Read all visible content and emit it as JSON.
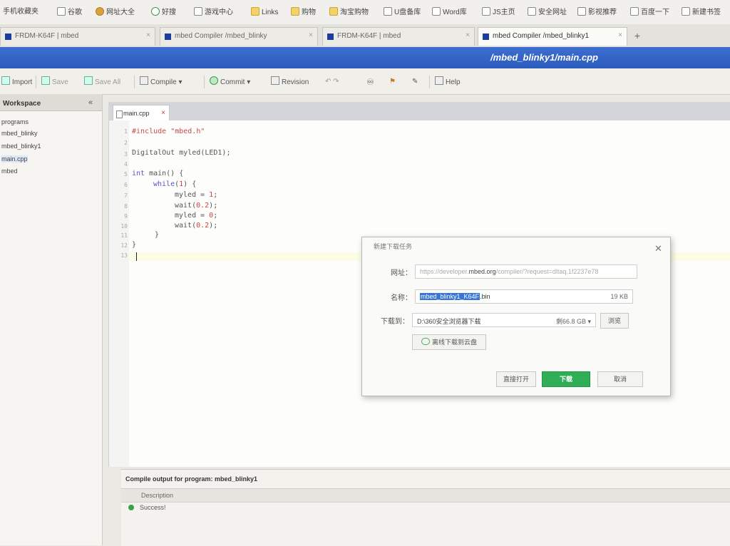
{
  "bookmarks": [
    {
      "label": "手机收藏夹"
    },
    {
      "label": "谷歌"
    },
    {
      "label": "网址大全"
    },
    {
      "label": "好搜"
    },
    {
      "label": "游戏中心"
    },
    {
      "label": "Links"
    },
    {
      "label": "购物"
    },
    {
      "label": "淘宝购物"
    },
    {
      "label": "U盘备库"
    },
    {
      "label": "Word库"
    },
    {
      "label": "JS主页"
    },
    {
      "label": "安全网址"
    },
    {
      "label": "影视推荐"
    },
    {
      "label": "百度一下"
    },
    {
      "label": "新建书签"
    }
  ],
  "tabs": [
    {
      "label": "FRDM-K64F | mbed"
    },
    {
      "label": "mbed Compiler /mbed_blinky"
    },
    {
      "label": "FRDM-K64F | mbed"
    },
    {
      "label": "mbed Compiler /mbed_blinky1"
    }
  ],
  "new_tab": "+",
  "file_path": "/mbed_blinky1/main.cpp",
  "toolbar": {
    "import": "Import",
    "save": "Save",
    "save_all": "Save All",
    "compile": "Compile",
    "commit": "Commit",
    "revision": "Revision",
    "help": "Help"
  },
  "workspace": {
    "title": "Workspace",
    "collapse": "«",
    "items": [
      "programs",
      "mbed_blinky",
      "mbed_blinky1",
      "main.cpp",
      "mbed"
    ]
  },
  "editor": {
    "tab": "main.cpp",
    "tab_close": "×",
    "line_numbers": [
      "1",
      "2",
      "3",
      "4",
      "5",
      "6",
      "7",
      "8",
      "9",
      "10",
      "11",
      "12",
      "13"
    ],
    "code": {
      "l1_kw": "#include",
      "l1_str": "\"mbed.h\"",
      "l3": "DigitalOut myled(LED1);",
      "l5_kw": "int",
      "l5_rest": " main() {",
      "l6_kw": "while",
      "l6_a": "(",
      "l6_num": "1",
      "l6_b": ") {",
      "l7_a": "myled = ",
      "l7_num": "1",
      "l7_b": ";",
      "l8_a": "wait(",
      "l8_num": "0.2",
      "l8_b": ");",
      "l9_a": "myled = ",
      "l9_num": "0",
      "l9_b": ";",
      "l10_a": "wait(",
      "l10_num": "0.2",
      "l10_b": ");",
      "l11": "}",
      "l12": "}"
    }
  },
  "output": {
    "title": "Compile output for program: mbed_blinky1",
    "column": "Description",
    "status": "Success!"
  },
  "dialog": {
    "title": "新建下载任务",
    "close": "✕",
    "url_label": "网址：",
    "url_prefix": "https://developer.",
    "url_host": "mbed.org",
    "url_suffix": "/compiler/?request=dltaq.1f2237e78",
    "name_label": "名称：",
    "name_selected": "mbed_blinky1_K64F",
    "name_ext": ".bin",
    "size": "19 KB",
    "path_label": "下载到：",
    "path_value": "D:\\360安全浏览器下载",
    "free_space": "剩66.8 GB ▾",
    "browse": "浏览",
    "cloud": "离线下载到云盘",
    "open_direct": "直接打开",
    "download": "下载",
    "cancel": "取消"
  }
}
